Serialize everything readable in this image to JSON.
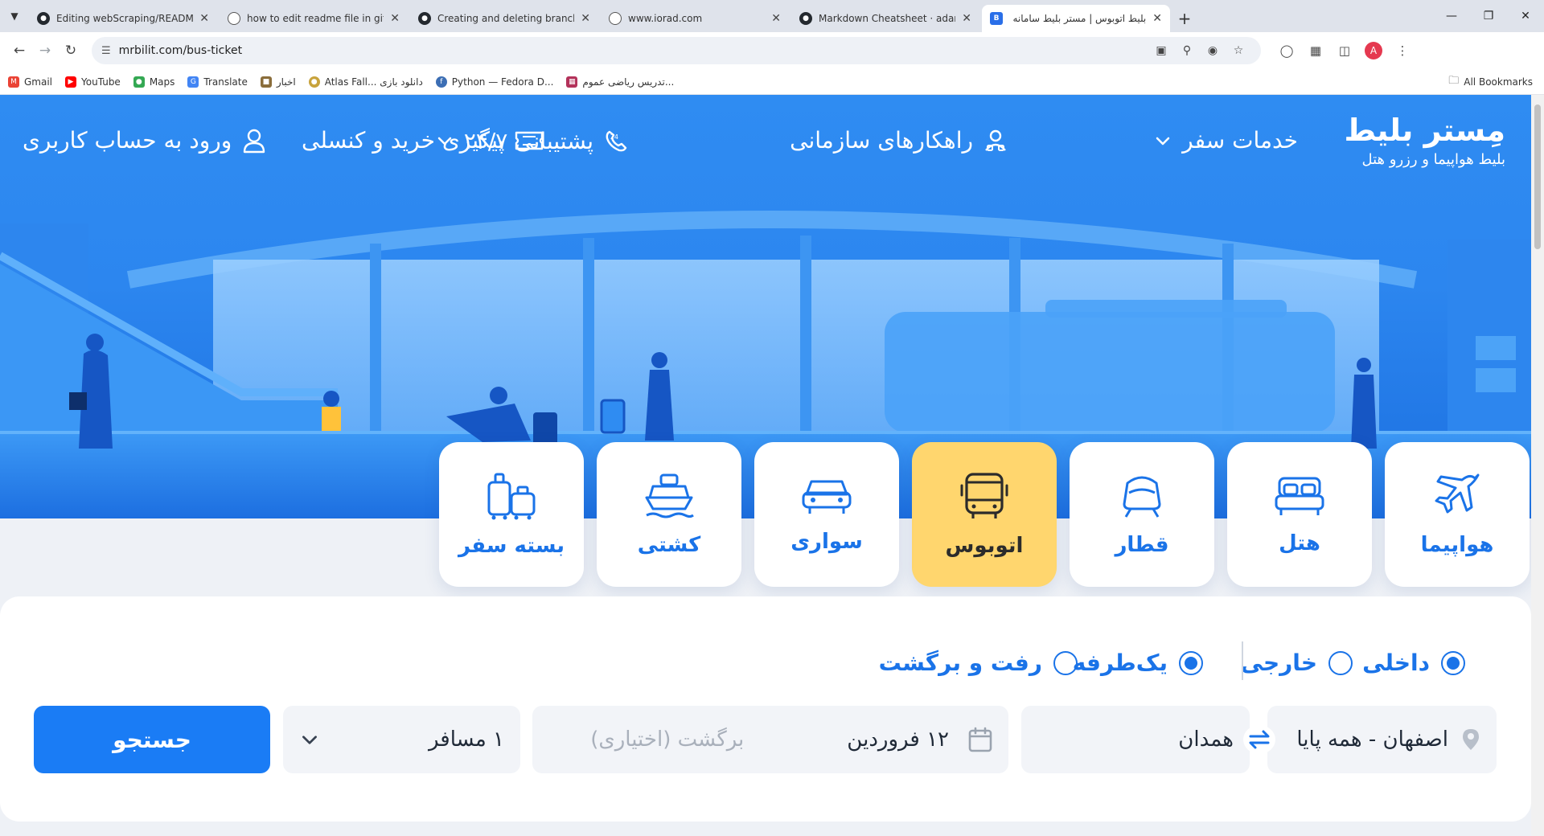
{
  "browser": {
    "tabs": [
      {
        "title": "Editing webScraping/README.md",
        "icon": "github-icon",
        "active": false
      },
      {
        "title": "how to edit readme file in github",
        "icon": "globe-icon",
        "active": false
      },
      {
        "title": "Creating and deleting branches",
        "icon": "github-icon",
        "active": false
      },
      {
        "title": "www.iorad.com",
        "icon": "globe-icon",
        "active": false
      },
      {
        "title": "Markdown Cheatsheet · adam-p",
        "icon": "github-icon",
        "active": false
      },
      {
        "title": "بلیط اتوبوس | مستر بلیط سامانه",
        "icon": "mrbilit-icon",
        "active": true
      }
    ],
    "url": "mrbilit.com/bus-ticket",
    "profile_initial": "A",
    "bookmarks": [
      {
        "label": "Gmail",
        "color": "#ea4335"
      },
      {
        "label": "YouTube",
        "color": "#ff0000"
      },
      {
        "label": "Maps",
        "color": "#34a853"
      },
      {
        "label": "Translate",
        "color": "#4285f4"
      },
      {
        "label": "اخبار",
        "color": "#8a6d3b"
      },
      {
        "label": "Atlas Fall... دانلود بازی",
        "color": "#c8a33c"
      },
      {
        "label": "Python — Fedora D...",
        "color": "#3c6eb4"
      },
      {
        "label": "تدریس ریاضی عموم...",
        "color": "#b3325a"
      }
    ],
    "all_bookmarks": "All Bookmarks"
  },
  "site": {
    "logo": "مِستر بلیط",
    "tagline": "بلیط هواپیما و رزرو هتل",
    "nav": {
      "travel_services": "خدمات سفر",
      "corporate": "راهکارهای سازمانی",
      "support": "پشتیبانی ۲۴/۷",
      "tracking": "پیگیری خرید و کنسلی",
      "login": "ورود به حساب کاربری"
    },
    "services": [
      {
        "label": "هواپیما",
        "icon": "airplane-icon",
        "active": false
      },
      {
        "label": "هتل",
        "icon": "bed-icon",
        "active": false
      },
      {
        "label": "قطار",
        "icon": "train-icon",
        "active": false
      },
      {
        "label": "اتوبوس",
        "icon": "bus-icon",
        "active": true
      },
      {
        "label": "سواری",
        "icon": "car-icon",
        "active": false
      },
      {
        "label": "کشتی",
        "icon": "ship-icon",
        "active": false
      },
      {
        "label": "بسته سفر",
        "icon": "luggage-icon",
        "active": false
      }
    ],
    "search": {
      "domestic": "داخلی",
      "international": "خارجی",
      "one_way": "یک‌طرفه",
      "round_trip": "رفت و برگشت",
      "origin": "اصفهان - همه پایا",
      "destination": "همدان",
      "depart_date": "۱۲ فروردین",
      "return_placeholder": "برگشت (اختیاری)",
      "passengers": "۱ مسافر",
      "button": "جستجو"
    },
    "colors": {
      "primary": "#1a73e8",
      "active_card": "#ffd66e",
      "hero": "#2c86ef"
    }
  }
}
